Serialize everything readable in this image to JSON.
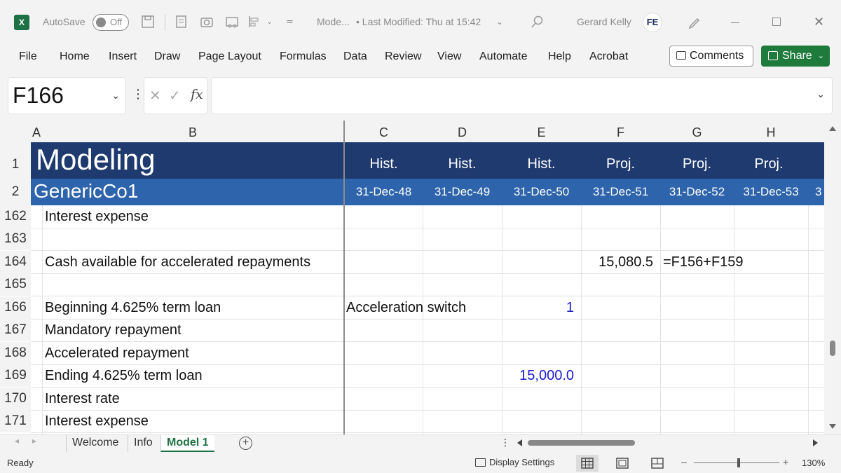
{
  "titlebar": {
    "app_icon": "excel-icon",
    "autosave_label": "AutoSave",
    "autosave_state": "Off",
    "doc_title": "Mode...",
    "modified": "• Last Modified: Thu at 15:42",
    "user_name": "Gerard Kelly",
    "user_initials": "FE"
  },
  "menu": {
    "items": [
      "File",
      "Home",
      "Insert",
      "Draw",
      "Page Layout",
      "Formulas",
      "Data",
      "Review",
      "View",
      "Automate",
      "Help",
      "Acrobat"
    ],
    "comments_label": "Comments",
    "share_label": "Share"
  },
  "formula_bar": {
    "name_box": "F166",
    "formula": "",
    "cancel_glyph": "✕",
    "enter_glyph": "✓",
    "fx_glyph": "fx"
  },
  "grid": {
    "columns": [
      "A",
      "B",
      "C",
      "D",
      "E",
      "F",
      "G",
      "H"
    ],
    "banner": {
      "title": "Modeling",
      "company": "GenericCo1",
      "period_types": [
        "Hist.",
        "Hist.",
        "Hist.",
        "Proj.",
        "Proj.",
        "Proj."
      ],
      "dates": [
        "31-Dec-48",
        "31-Dec-49",
        "31-Dec-50",
        "31-Dec-51",
        "31-Dec-52",
        "31-Dec-53"
      ],
      "date_overflow": "3"
    },
    "header_rows": [
      "1",
      "2"
    ],
    "rows": [
      {
        "num": "162",
        "label": "Interest expense"
      },
      {
        "num": "163",
        "label": ""
      },
      {
        "num": "164",
        "label": "Cash available for accelerated repayments"
      },
      {
        "num": "165",
        "label": ""
      },
      {
        "num": "166",
        "label": "Beginning 4.625% term loan"
      },
      {
        "num": "167",
        "label": "Mandatory repayment"
      },
      {
        "num": "168",
        "label": "Accelerated repayment"
      },
      {
        "num": "169",
        "label": "Ending 4.625% term loan"
      },
      {
        "num": "170",
        "label": "Interest rate"
      },
      {
        "num": "171",
        "label": "Interest expense"
      }
    ],
    "cells": {
      "f164": "15,080.5",
      "g164": "=F156+F159",
      "c166": "Acceleration switch",
      "e166": "1",
      "e169": "15,000.0"
    },
    "input_color": "#1a1acc",
    "banner_dark": "#1f3a6e",
    "banner_light": "#2e64ac"
  },
  "sheets": {
    "tabs": [
      "Welcome",
      "Info",
      "Model 1"
    ],
    "active": "Model 1"
  },
  "status": {
    "ready": "Ready",
    "display_settings": "Display Settings",
    "zoom": "130%",
    "zoom_minus": "–",
    "zoom_plus": "+"
  }
}
